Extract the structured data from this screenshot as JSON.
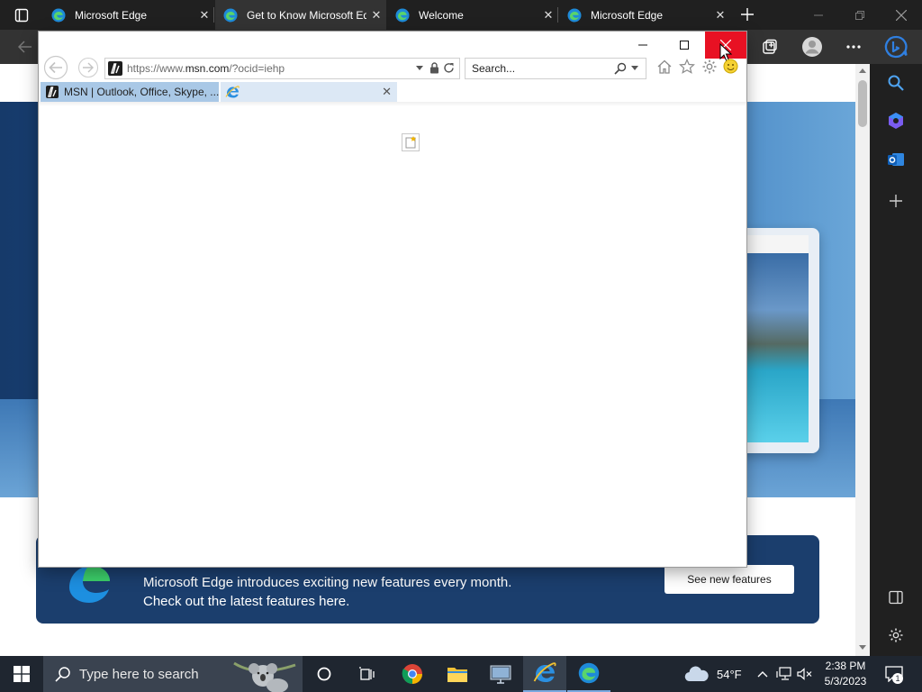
{
  "edge": {
    "tabs": [
      {
        "title": "Microsoft Edge",
        "active": false
      },
      {
        "title": "Get to Know Microsoft Edge",
        "active": true
      },
      {
        "title": "Welcome",
        "active": false
      },
      {
        "title": "Microsoft Edge",
        "active": false
      }
    ],
    "page": {
      "promo_text": "Microsoft Edge introduces exciting new features every month. Check out the latest features here.",
      "promo_button": "See new features"
    },
    "sidebar_icons": [
      "search-icon",
      "bing-chat-icon",
      "outlook-icon",
      "add-icon",
      "split-screen-icon",
      "settings-icon"
    ]
  },
  "ie": {
    "url_prefix": "https://www.",
    "url_domain": "msn.com",
    "url_suffix": "/?ocid=iehp",
    "search_placeholder": "Search...",
    "tabs": [
      {
        "title": "MSN | Outlook, Office, Skype, ..."
      },
      {
        "title": ""
      }
    ]
  },
  "taskbar": {
    "search_placeholder": "Type here to search",
    "weather_temp": "54°F",
    "time": "2:38 PM",
    "date": "5/3/2023",
    "notification_count": "1"
  },
  "colors": {
    "ie_close_hover": "#e81123",
    "edge_promo_bg": "#1b3e6d"
  }
}
